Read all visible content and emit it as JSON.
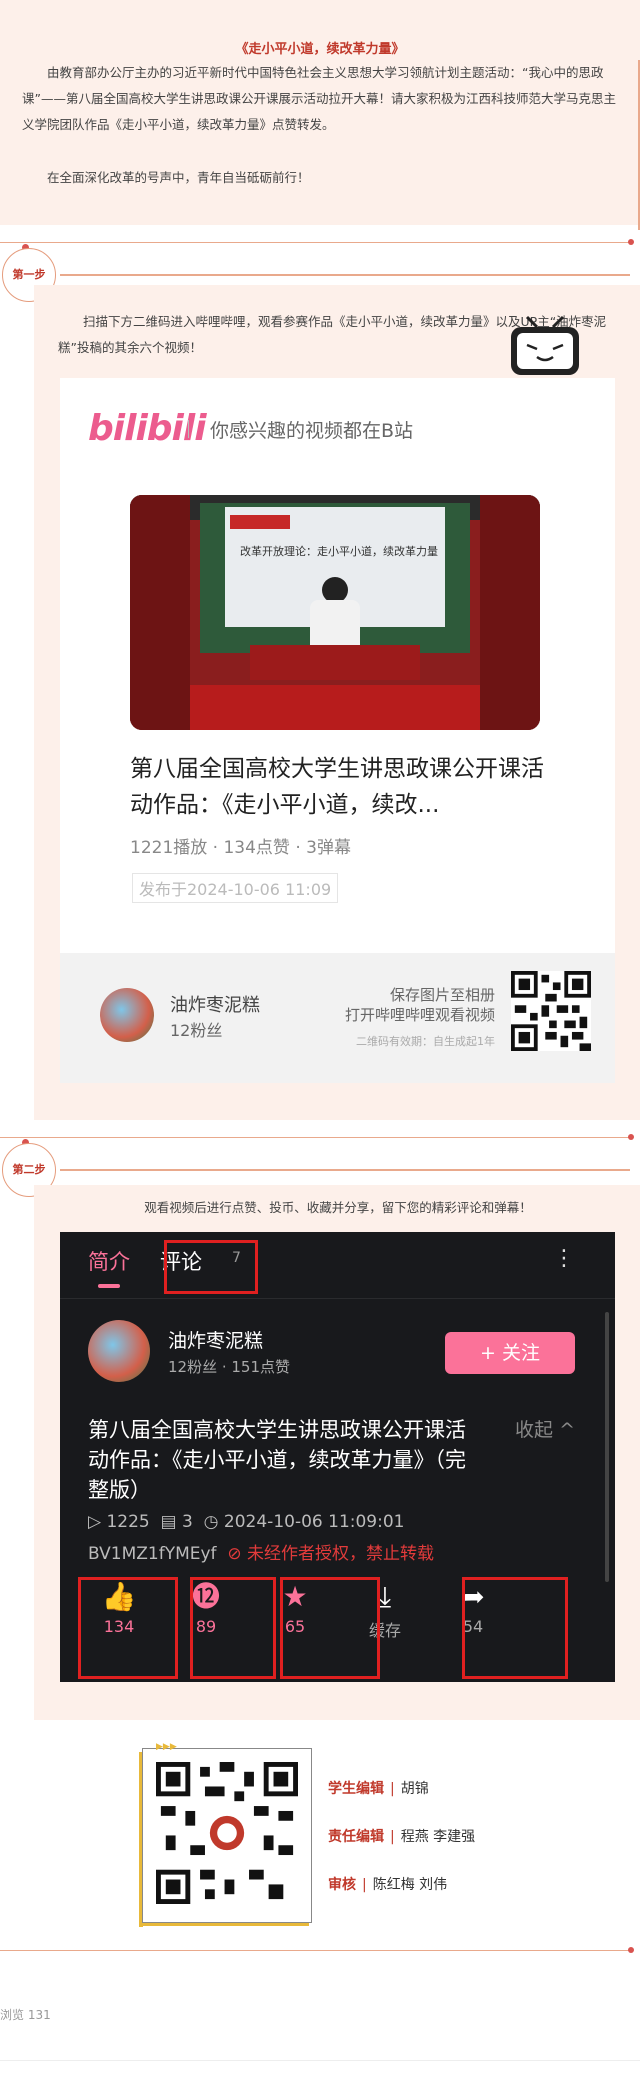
{
  "intro": {
    "title": "《走小平小道，续改革力量》",
    "para1": "由教育部办公厅主办的习近平新时代中国特色社会主义思想大学习领航计划主题活动：“我心中的思政课”——第八届全国高校大学生讲思政课公开课展示活动拉开大幕！请大家积极为江西科技师范大学马克思主义学院团队作品《走小平小道，续改革力量》点赞转发。",
    "para2": "在全面深化改革的号声中，青年自当砥砺前行！"
  },
  "step1": {
    "label": "第一步",
    "instruction": "扫描下方二维码进入哔哩哔哩，观看参赛作品《走小平小道，续改革力量》以及UP主“油炸枣泥糕”投稿的其余六个视频！"
  },
  "bili_card": {
    "logo": "bilibili",
    "slogan": "你感兴趣的视频都在B站",
    "video_title": "第八届全国高校大学生讲思政课公开课活动作品：《走小平小道，续改...",
    "thumb_caption": "改革开放理论：走小平小道，续改革力量",
    "meta": "1221播放 · 134点赞 · 3弹幕",
    "date": "发布于2024-10-06 11:09",
    "up_name": "油炸枣泥糕",
    "up_fans": "12粉丝",
    "save_line1": "保存图片至相册",
    "save_line2": "打开哔哩哔哩观看视频",
    "validity": "二维码有效期：自生成起1年"
  },
  "step2": {
    "label": "第二步",
    "instruction": "观看视频后进行点赞、投币、收藏并分享，留下您的精彩评论和弹幕！"
  },
  "app": {
    "tab_intro": "简介",
    "tab_comments": "评论",
    "comment_count": "7",
    "up_name": "油炸枣泥糕",
    "up_stats": "12粉丝 · 151点赞",
    "follow_label": "+ 关注",
    "title": "第八届全国高校大学生讲思政课公开课活动作品：《走小平小道，续改革力量》（完整版）",
    "fold_label": "收起 ^",
    "plays": "1225",
    "danmaku": "3",
    "pubtime": "2024-10-06 11:09:01",
    "bvid": "BV1MZ1fYMEyf",
    "notice": "未经作者授权，禁止转载",
    "actions": {
      "like": "134",
      "coin": "89",
      "fav": "65",
      "cache": "缓存",
      "share": "54"
    }
  },
  "credits": {
    "student_editor_role": "学生编辑",
    "student_editor": "胡锦",
    "duty_editor_role": "责任编辑",
    "duty_editor": "程燕 李建强",
    "review_role": "审核",
    "review": "陈红梅 刘伟"
  },
  "footer": {
    "views": "浏览 131"
  },
  "colors": {
    "accent": "#c0392b",
    "bili_pink": "#fb7299",
    "panel_bg": "#fdf0ea"
  }
}
